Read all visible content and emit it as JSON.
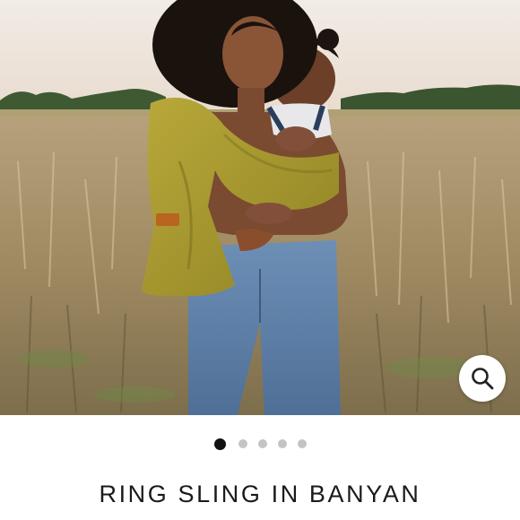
{
  "product": {
    "title": "RING SLING IN BANYAN"
  },
  "gallery": {
    "image_count": 5,
    "active_index": 0,
    "zoom_icon": "magnifier-icon"
  },
  "colors": {
    "sling": "#a89a2c",
    "denim": "#5b7fa8",
    "active_dot": "#111111",
    "inactive_dot": "#c4c4c4"
  }
}
